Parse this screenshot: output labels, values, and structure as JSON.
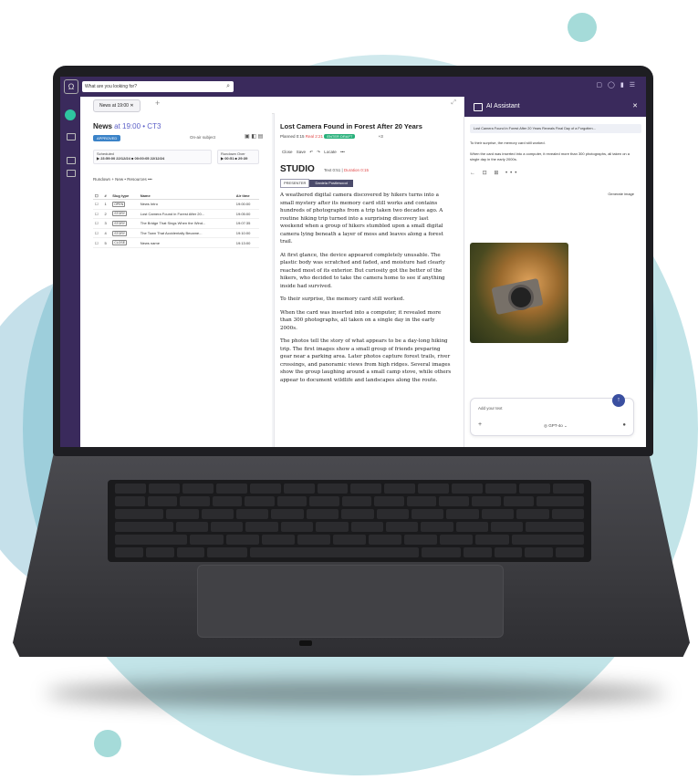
{
  "app": {
    "search_placeholder": "What are you looking for?",
    "logo_letter": "Ω"
  },
  "tab": {
    "label": "News at 19:00"
  },
  "rundown": {
    "title": "News",
    "title_time": "at 19:00 • CT3",
    "status": "APPROVED",
    "filter": "On-air subject",
    "scheduled_label": "Scheduled",
    "scheduled_value": "▶ 23:59:00 22/12/24  ■ 00:00:05 22/12/24",
    "duration_label": "Rundown Over",
    "duration_value": "▶ 00:51  ■ 29:39",
    "toolbar": "Rundown  +  New  •  Resources  •••",
    "columns": [
      "#",
      "Slug type",
      "Name",
      "Air time"
    ],
    "rows": [
      {
        "n": "1",
        "slug": "OPEN",
        "name": "News Intro",
        "time": "19:00:00"
      },
      {
        "n": "2",
        "slug": "STORY",
        "name": "Lost Camera Found in Forest After 20...",
        "time": "19:05:00"
      },
      {
        "n": "3",
        "slug": "STORY",
        "name": "The Bridge That Sings When the Wind...",
        "time": "19:07:35"
      },
      {
        "n": "4",
        "slug": "STORY",
        "name": "The Town That Accidentally Became...",
        "time": "19:10:00"
      },
      {
        "n": "5",
        "slug": "CLOSE",
        "name": "News name",
        "time": "19:13:00"
      }
    ]
  },
  "story": {
    "title": "Lost Camera Found in Forest After 20 Years",
    "meta_planned": "Planned 0:15",
    "meta_real": "Real 2:21",
    "meta_tag": "ENTER DRAFT",
    "meta_right": "+3",
    "tools": "Close  Save  ↶ ↷  Locate  •••",
    "studio": "STUDIO",
    "studio_time": "Text 0:51",
    "studio_dur": "Duration 0:15",
    "presenter_label": "PRESENTER",
    "presenter_name": "Daniela Postlewood",
    "paragraphs": [
      "A weathered digital camera discovered by hikers turns into a small mystery after its memory card still works and contains hundreds of photographs from a trip taken two decades ago. A routine hiking trip turned into a surprising discovery last weekend when a group of hikers stumbled upon a small digital camera lying beneath a layer of moss and leaves along a forest trail.",
      "At first glance, the device appeared completely unusable. The plastic body was scratched and faded, and moisture had clearly reached most of its exterior. But curiosity got the better of the hikers, who decided to take the camera home to see if anything inside had survived.",
      "To their surprise, the memory card still worked.",
      "When the card was inserted into a computer, it revealed more than 300 photographs, all taken on a single day in the early 2000s.",
      "The photos tell the story of what appears to be a day-long hiking trip. The first images show a small group of friends preparing gear near a parking area. Later photos capture forest trails, river crossings, and panoramic views from high ridges. Several images show the group laughing around a small camp stove, while others appear to document wildlife and landscapes along the route."
    ]
  },
  "assistant": {
    "title": "AI Assistant",
    "context": "Lost Camera Found in Forest After 20 Years Reveals Final Day of a Forgotten...",
    "msg1": "To their surprise, the memory card still worked.",
    "msg2": "When the card was inserted into a computer, it revealed more than 300 photographs, all taken on a single day in the early 2000s.",
    "actions": "← ⊡ ⊞ •••",
    "generate": "Generate image",
    "input_placeholder": "Add your text",
    "model": "GPT-4o",
    "send_icon": "arrow-up",
    "close": "✕"
  }
}
